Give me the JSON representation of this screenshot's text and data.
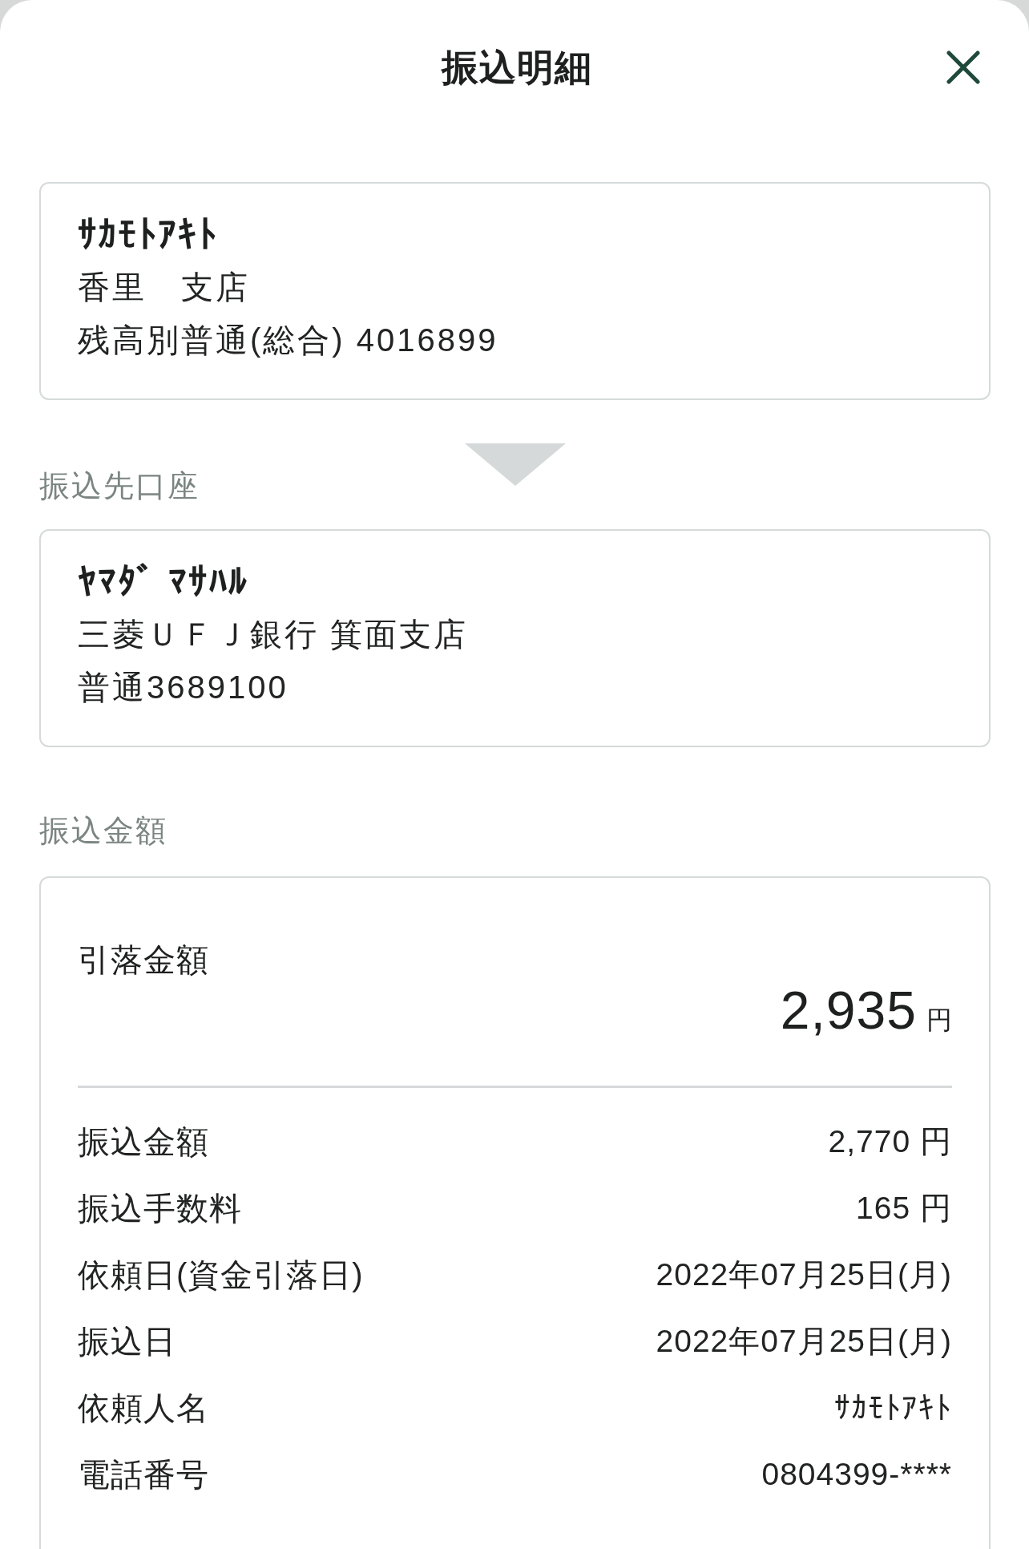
{
  "header": {
    "title": "振込明細"
  },
  "from_account": {
    "name": "ｻｶﾓﾄｱｷﾄ",
    "branch": "香里　支店",
    "account": "残高別普通(総合) 4016899"
  },
  "to_account": {
    "label": "振込先口座",
    "name": "ﾔﾏﾀﾞ ﾏｻﾊﾙ",
    "branch": "三菱ＵＦＪ銀行 箕面支店",
    "account": "普通3689100"
  },
  "transfer_amount": {
    "label": "振込金額",
    "total": {
      "label": "引落金額",
      "amount": "2,935",
      "unit": "円"
    },
    "details": [
      {
        "label": "振込金額",
        "value": "2,770 円"
      },
      {
        "label": "振込手数料",
        "value": "165 円"
      },
      {
        "label": "依頼日(資金引落日)",
        "value": "2022年07月25日(月)"
      },
      {
        "label": "振込日",
        "value": "2022年07月25日(月)"
      },
      {
        "label": "依頼人名",
        "value": "ｻｶﾓﾄｱｷﾄ"
      },
      {
        "label": "電話番号",
        "value": "0804399-****"
      }
    ]
  }
}
